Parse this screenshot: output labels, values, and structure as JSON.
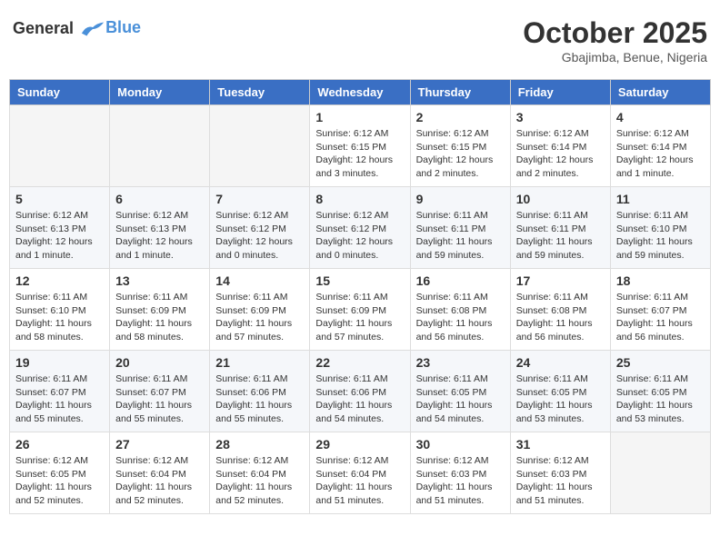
{
  "header": {
    "logo_line1": "General",
    "logo_line2": "Blue",
    "month": "October 2025",
    "location": "Gbajimba, Benue, Nigeria"
  },
  "weekdays": [
    "Sunday",
    "Monday",
    "Tuesday",
    "Wednesday",
    "Thursday",
    "Friday",
    "Saturday"
  ],
  "weeks": [
    [
      {
        "day": "",
        "info": ""
      },
      {
        "day": "",
        "info": ""
      },
      {
        "day": "",
        "info": ""
      },
      {
        "day": "1",
        "info": "Sunrise: 6:12 AM\nSunset: 6:15 PM\nDaylight: 12 hours\nand 3 minutes."
      },
      {
        "day": "2",
        "info": "Sunrise: 6:12 AM\nSunset: 6:15 PM\nDaylight: 12 hours\nand 2 minutes."
      },
      {
        "day": "3",
        "info": "Sunrise: 6:12 AM\nSunset: 6:14 PM\nDaylight: 12 hours\nand 2 minutes."
      },
      {
        "day": "4",
        "info": "Sunrise: 6:12 AM\nSunset: 6:14 PM\nDaylight: 12 hours\nand 1 minute."
      }
    ],
    [
      {
        "day": "5",
        "info": "Sunrise: 6:12 AM\nSunset: 6:13 PM\nDaylight: 12 hours\nand 1 minute."
      },
      {
        "day": "6",
        "info": "Sunrise: 6:12 AM\nSunset: 6:13 PM\nDaylight: 12 hours\nand 1 minute."
      },
      {
        "day": "7",
        "info": "Sunrise: 6:12 AM\nSunset: 6:12 PM\nDaylight: 12 hours\nand 0 minutes."
      },
      {
        "day": "8",
        "info": "Sunrise: 6:12 AM\nSunset: 6:12 PM\nDaylight: 12 hours\nand 0 minutes."
      },
      {
        "day": "9",
        "info": "Sunrise: 6:11 AM\nSunset: 6:11 PM\nDaylight: 11 hours\nand 59 minutes."
      },
      {
        "day": "10",
        "info": "Sunrise: 6:11 AM\nSunset: 6:11 PM\nDaylight: 11 hours\nand 59 minutes."
      },
      {
        "day": "11",
        "info": "Sunrise: 6:11 AM\nSunset: 6:10 PM\nDaylight: 11 hours\nand 59 minutes."
      }
    ],
    [
      {
        "day": "12",
        "info": "Sunrise: 6:11 AM\nSunset: 6:10 PM\nDaylight: 11 hours\nand 58 minutes."
      },
      {
        "day": "13",
        "info": "Sunrise: 6:11 AM\nSunset: 6:09 PM\nDaylight: 11 hours\nand 58 minutes."
      },
      {
        "day": "14",
        "info": "Sunrise: 6:11 AM\nSunset: 6:09 PM\nDaylight: 11 hours\nand 57 minutes."
      },
      {
        "day": "15",
        "info": "Sunrise: 6:11 AM\nSunset: 6:09 PM\nDaylight: 11 hours\nand 57 minutes."
      },
      {
        "day": "16",
        "info": "Sunrise: 6:11 AM\nSunset: 6:08 PM\nDaylight: 11 hours\nand 56 minutes."
      },
      {
        "day": "17",
        "info": "Sunrise: 6:11 AM\nSunset: 6:08 PM\nDaylight: 11 hours\nand 56 minutes."
      },
      {
        "day": "18",
        "info": "Sunrise: 6:11 AM\nSunset: 6:07 PM\nDaylight: 11 hours\nand 56 minutes."
      }
    ],
    [
      {
        "day": "19",
        "info": "Sunrise: 6:11 AM\nSunset: 6:07 PM\nDaylight: 11 hours\nand 55 minutes."
      },
      {
        "day": "20",
        "info": "Sunrise: 6:11 AM\nSunset: 6:07 PM\nDaylight: 11 hours\nand 55 minutes."
      },
      {
        "day": "21",
        "info": "Sunrise: 6:11 AM\nSunset: 6:06 PM\nDaylight: 11 hours\nand 55 minutes."
      },
      {
        "day": "22",
        "info": "Sunrise: 6:11 AM\nSunset: 6:06 PM\nDaylight: 11 hours\nand 54 minutes."
      },
      {
        "day": "23",
        "info": "Sunrise: 6:11 AM\nSunset: 6:05 PM\nDaylight: 11 hours\nand 54 minutes."
      },
      {
        "day": "24",
        "info": "Sunrise: 6:11 AM\nSunset: 6:05 PM\nDaylight: 11 hours\nand 53 minutes."
      },
      {
        "day": "25",
        "info": "Sunrise: 6:11 AM\nSunset: 6:05 PM\nDaylight: 11 hours\nand 53 minutes."
      }
    ],
    [
      {
        "day": "26",
        "info": "Sunrise: 6:12 AM\nSunset: 6:05 PM\nDaylight: 11 hours\nand 52 minutes."
      },
      {
        "day": "27",
        "info": "Sunrise: 6:12 AM\nSunset: 6:04 PM\nDaylight: 11 hours\nand 52 minutes."
      },
      {
        "day": "28",
        "info": "Sunrise: 6:12 AM\nSunset: 6:04 PM\nDaylight: 11 hours\nand 52 minutes."
      },
      {
        "day": "29",
        "info": "Sunrise: 6:12 AM\nSunset: 6:04 PM\nDaylight: 11 hours\nand 51 minutes."
      },
      {
        "day": "30",
        "info": "Sunrise: 6:12 AM\nSunset: 6:03 PM\nDaylight: 11 hours\nand 51 minutes."
      },
      {
        "day": "31",
        "info": "Sunrise: 6:12 AM\nSunset: 6:03 PM\nDaylight: 11 hours\nand 51 minutes."
      },
      {
        "day": "",
        "info": ""
      }
    ]
  ]
}
